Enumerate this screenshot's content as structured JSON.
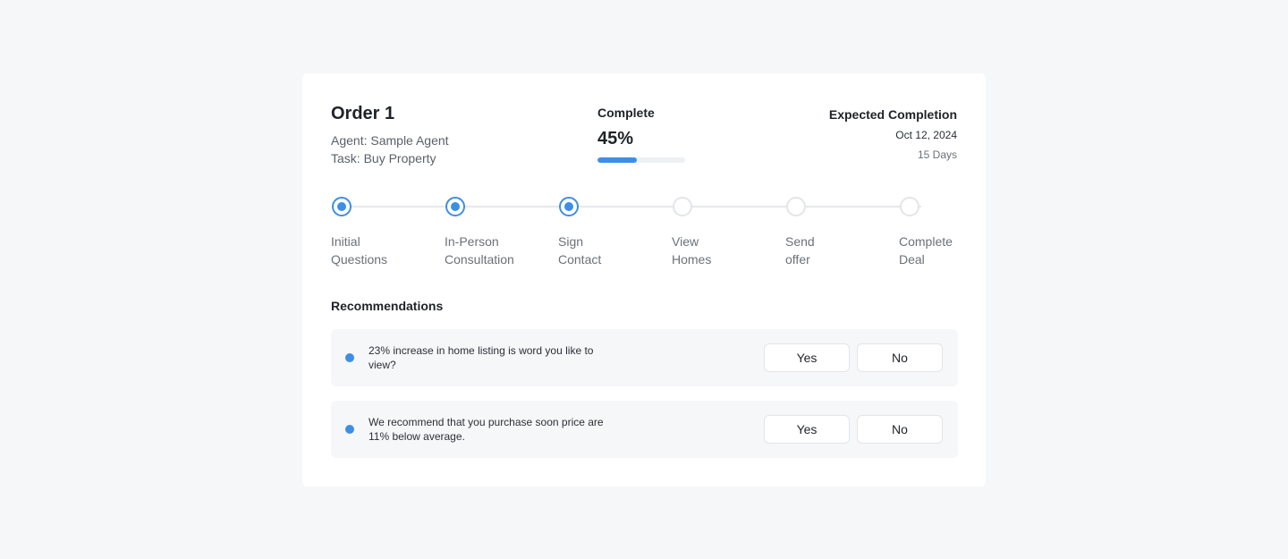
{
  "order": {
    "title": "Order 1",
    "agent": "Agent: Sample Agent",
    "task": "Task: Buy Property"
  },
  "progress": {
    "label": "Complete",
    "percent_text": "45%",
    "percent": 0.45,
    "accent_color": "#3d8fe6"
  },
  "expected": {
    "label": "Expected Completion",
    "date": "Oct 12, 2024",
    "days": "15 Days"
  },
  "steps": [
    {
      "line1": "Initial",
      "line2": "Questions",
      "done": true
    },
    {
      "line1": "In-Person",
      "line2": "Consultation",
      "done": true
    },
    {
      "line1": "Sign",
      "line2": "Contact",
      "done": true
    },
    {
      "line1": "View",
      "line2": "Homes",
      "done": false
    },
    {
      "line1": "Send",
      "line2": "offer",
      "done": false
    },
    {
      "line1": "Complete",
      "line2": "Deal",
      "done": false
    }
  ],
  "recommendations": {
    "title": "Recommendations",
    "items": [
      {
        "text": "23% increase in home listing is word you like to view?",
        "yes_label": "Yes",
        "no_label": "No"
      },
      {
        "text": "We recommend that you purchase soon price are 11% below average.",
        "yes_label": "Yes",
        "no_label": "No"
      }
    ]
  }
}
